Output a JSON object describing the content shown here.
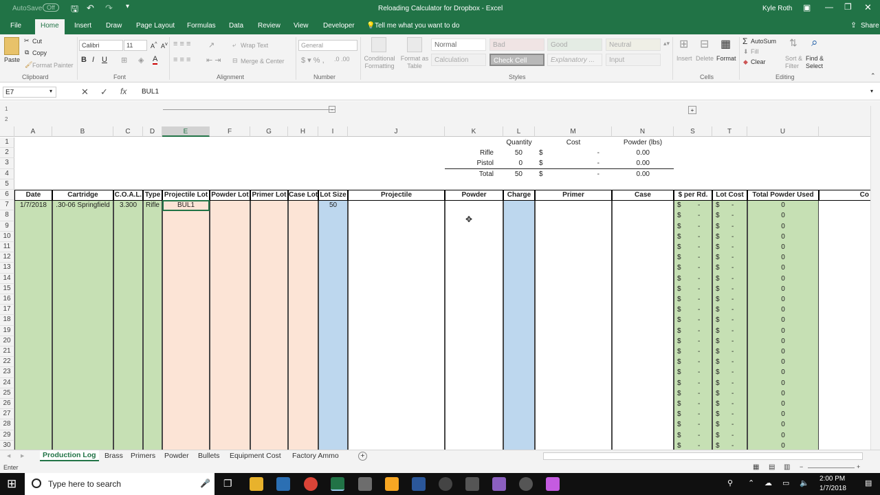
{
  "window": {
    "autosave_label": "AutoSave",
    "autosave_state": "Off",
    "title": "Reloading Calculator for Dropbox  -  Excel",
    "user": "Kyle Roth"
  },
  "tabs": [
    "File",
    "Home",
    "Insert",
    "Draw",
    "Page Layout",
    "Formulas",
    "Data",
    "Review",
    "View",
    "Developer"
  ],
  "tell_me": "Tell me what you want to do",
  "share": "Share",
  "ribbon": {
    "clipboard": {
      "paste": "Paste",
      "cut": "Cut",
      "copy": "Copy",
      "format_painter": "Format Painter",
      "label": "Clipboard"
    },
    "font": {
      "name": "Calibri",
      "size": "11",
      "label": "Font"
    },
    "alignment": {
      "wrap": "Wrap Text",
      "merge": "Merge & Center",
      "label": "Alignment"
    },
    "number": {
      "format": "General",
      "label": "Number"
    },
    "styles": {
      "conditional": "Conditional Formatting",
      "format_as_table": "Format as Table",
      "normal": "Normal",
      "bad": "Bad",
      "good": "Good",
      "neutral": "Neutral",
      "calculation": "Calculation",
      "check_cell": "Check Cell",
      "explanatory": "Explanatory ...",
      "input": "Input",
      "label": "Styles"
    },
    "cells": {
      "insert": "Insert",
      "delete": "Delete",
      "format": "Format",
      "label": "Cells"
    },
    "editing": {
      "autosum": "AutoSum",
      "fill": "Fill",
      "clear": "Clear",
      "sort": "Sort & Filter",
      "find": "Find & Select",
      "label": "Editing"
    }
  },
  "formula_bar": {
    "name_box": "E7",
    "formula": "BUL1"
  },
  "grid": {
    "columns": [
      "A",
      "B",
      "C",
      "D",
      "E",
      "F",
      "G",
      "H",
      "I",
      "J",
      "K",
      "L",
      "M",
      "N",
      "S",
      "T",
      "U"
    ],
    "rows": [
      "1",
      "2",
      "3",
      "4",
      "5",
      "6",
      "7",
      "8",
      "9",
      "10",
      "11",
      "12",
      "13",
      "14",
      "15",
      "16",
      "17",
      "18",
      "19",
      "20",
      "21",
      "22",
      "23",
      "24",
      "25",
      "26",
      "27",
      "28",
      "29",
      "30"
    ],
    "summary": {
      "headers": {
        "quantity": "Quantity",
        "cost": "Cost",
        "powder": "Powder (lbs)"
      },
      "rows": [
        {
          "label": "Rifle",
          "qty": "50",
          "dollar": "$",
          "cost": "-",
          "powder": "0.00"
        },
        {
          "label": "Pistol",
          "qty": "0",
          "dollar": "$",
          "cost": "-",
          "powder": "0.00"
        },
        {
          "label": "Total",
          "qty": "50",
          "dollar": "$",
          "cost": "-",
          "powder": "0.00"
        }
      ]
    },
    "table_headers": [
      "Date",
      "Cartridge",
      "C.O.A.L.",
      "Type",
      "Projectile Lot",
      "Powder Lot",
      "Primer Lot",
      "Case Lot",
      "Lot Size",
      "Projectile",
      "Powder",
      "Charge",
      "Primer",
      "Case",
      "$ per Rd.",
      "Lot Cost",
      "Total Powder Used",
      "Co"
    ],
    "row7": {
      "date": "1/7/2018",
      "cartridge": ".30-06 Springfield",
      "coal": "3.300",
      "type": "Rifle",
      "projectile_lot": "BUL1",
      "lot_size": "50"
    },
    "dollar_sign": "$",
    "dash": "-",
    "zero": "0"
  },
  "sheets": [
    "Production Log",
    "Brass",
    "Primers",
    "Powder",
    "Bullets",
    "Equipment Cost",
    "Factory Ammo"
  ],
  "status": "Enter",
  "taskbar": {
    "search": "Type here to search",
    "time": "2:00 PM",
    "date": "1/7/2018"
  }
}
